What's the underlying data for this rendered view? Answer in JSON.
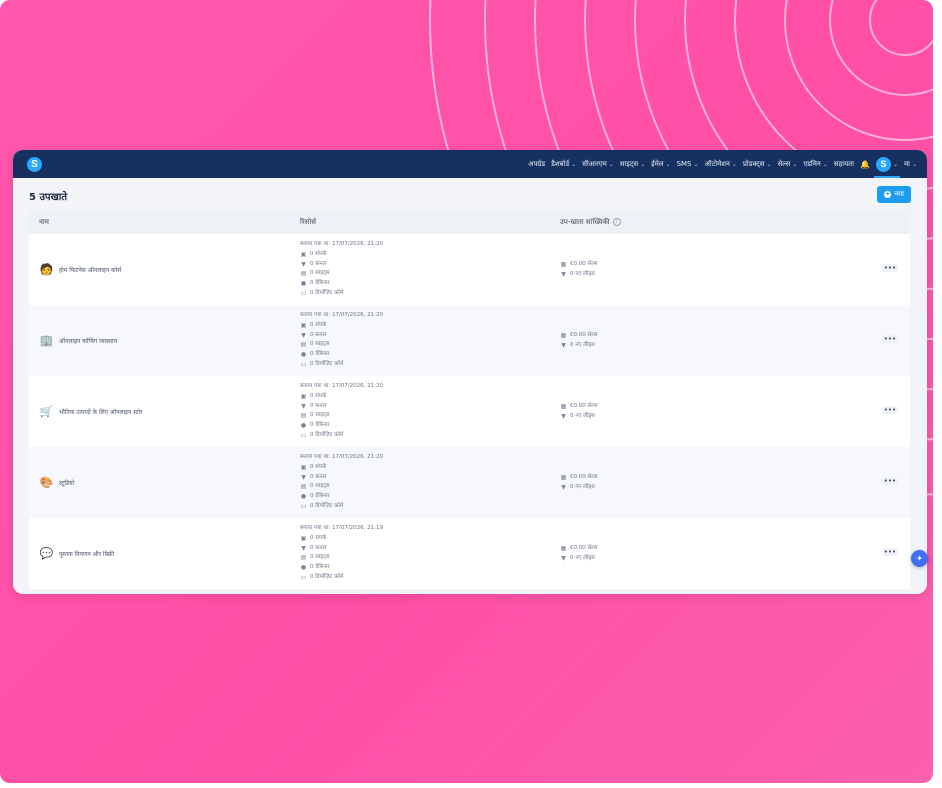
{
  "nav": {
    "items": [
      {
        "label": "अपग्रेड",
        "chevron": false
      },
      {
        "label": "डैशबोर्ड",
        "chevron": true
      },
      {
        "label": "सीआरएम",
        "chevron": true
      },
      {
        "label": "साइट्स",
        "chevron": true
      },
      {
        "label": "ईमेल",
        "chevron": true
      },
      {
        "label": "SMS",
        "chevron": true
      },
      {
        "label": "ऑटोमेशन",
        "chevron": true
      },
      {
        "label": "प्रोडक्ट्स",
        "chevron": true
      },
      {
        "label": "सेल्स",
        "chevron": true
      },
      {
        "label": "एडमिन",
        "chevron": true
      },
      {
        "label": "सहायता",
        "chevron": false
      }
    ],
    "avatar_letter": "S",
    "account_label": "मा"
  },
  "page": {
    "title": "5 उपखाते",
    "new_button": "नया"
  },
  "table": {
    "columns": [
      "नाम",
      "रिसोर्स",
      "उप-खाता सांख्यिकी"
    ],
    "rows": [
      {
        "icon": "plant-person-icon",
        "icon_glyph": "🧑",
        "name": "होम फिटनेस ऑनलाइन कोर्स",
        "created": "बनाया गया था: 17/07/2026, 21:20",
        "contacts": "0 संपर्क",
        "funnels": "0 फ़नल",
        "sites": "0 साइट्स",
        "webinars": "0 वेबिनार",
        "forms": "0 डिपॉज़िट फ़ॉर्म",
        "revenue": "€0.00 सेल्स",
        "leads": "0 नए लीड्स"
      },
      {
        "icon": "building-icon",
        "icon_glyph": "🏢",
        "name": "ऑनलाइन कोचिंग व्यवसाय",
        "created": "बनाया गया था: 17/07/2026, 21:20",
        "contacts": "0 संपर्क",
        "funnels": "0 फ़नल",
        "sites": "0 साइट्स",
        "webinars": "0 वेबिनार",
        "forms": "0 डिपॉज़िट फ़ॉर्म",
        "revenue": "€0.00 सेल्स",
        "leads": "0 नए लीड्स"
      },
      {
        "icon": "cart-icon",
        "icon_glyph": "🛒",
        "name": "भौतिक उत्पादों के लिए ऑनलाइन स्टोर",
        "created": "बनाया गया था: 17/07/2026, 21:20",
        "contacts": "0 संपर्क",
        "funnels": "0 फ़नल",
        "sites": "0 साइट्स",
        "webinars": "0 वेबिनार",
        "forms": "0 डिपॉज़िट फ़ॉर्म",
        "revenue": "€0.00 सेल्स",
        "leads": "0 नए लीड्स"
      },
      {
        "icon": "studio-icon",
        "icon_glyph": "🎨",
        "name": "स्टूडियो",
        "created": "बनाया गया था: 17/07/2026, 21:20",
        "contacts": "0 संपर्क",
        "funnels": "0 फ़नल",
        "sites": "0 साइट्स",
        "webinars": "0 वेबिनार",
        "forms": "0 डिपॉज़िट फ़ॉर्म",
        "revenue": "€0.00 सेल्स",
        "leads": "0 नए लीड्स"
      },
      {
        "icon": "chat-bubble-icon",
        "icon_glyph": "💬",
        "name": "पुस्तक विपणन और बिक्री",
        "created": "बनाया गया था: 17/07/2026, 21:19",
        "contacts": "0 संपर्क",
        "funnels": "0 फ़नल",
        "sites": "0 साइट्स",
        "webinars": "0 वेबिनार",
        "forms": "0 डिपॉज़िट फ़ॉर्म",
        "revenue": "€0.00 सेल्स",
        "leads": "0 नए लीड्स"
      }
    ]
  },
  "colors": {
    "navbar": "#16305f",
    "accent": "#1e9cf0",
    "background": "#ff4fa6"
  }
}
